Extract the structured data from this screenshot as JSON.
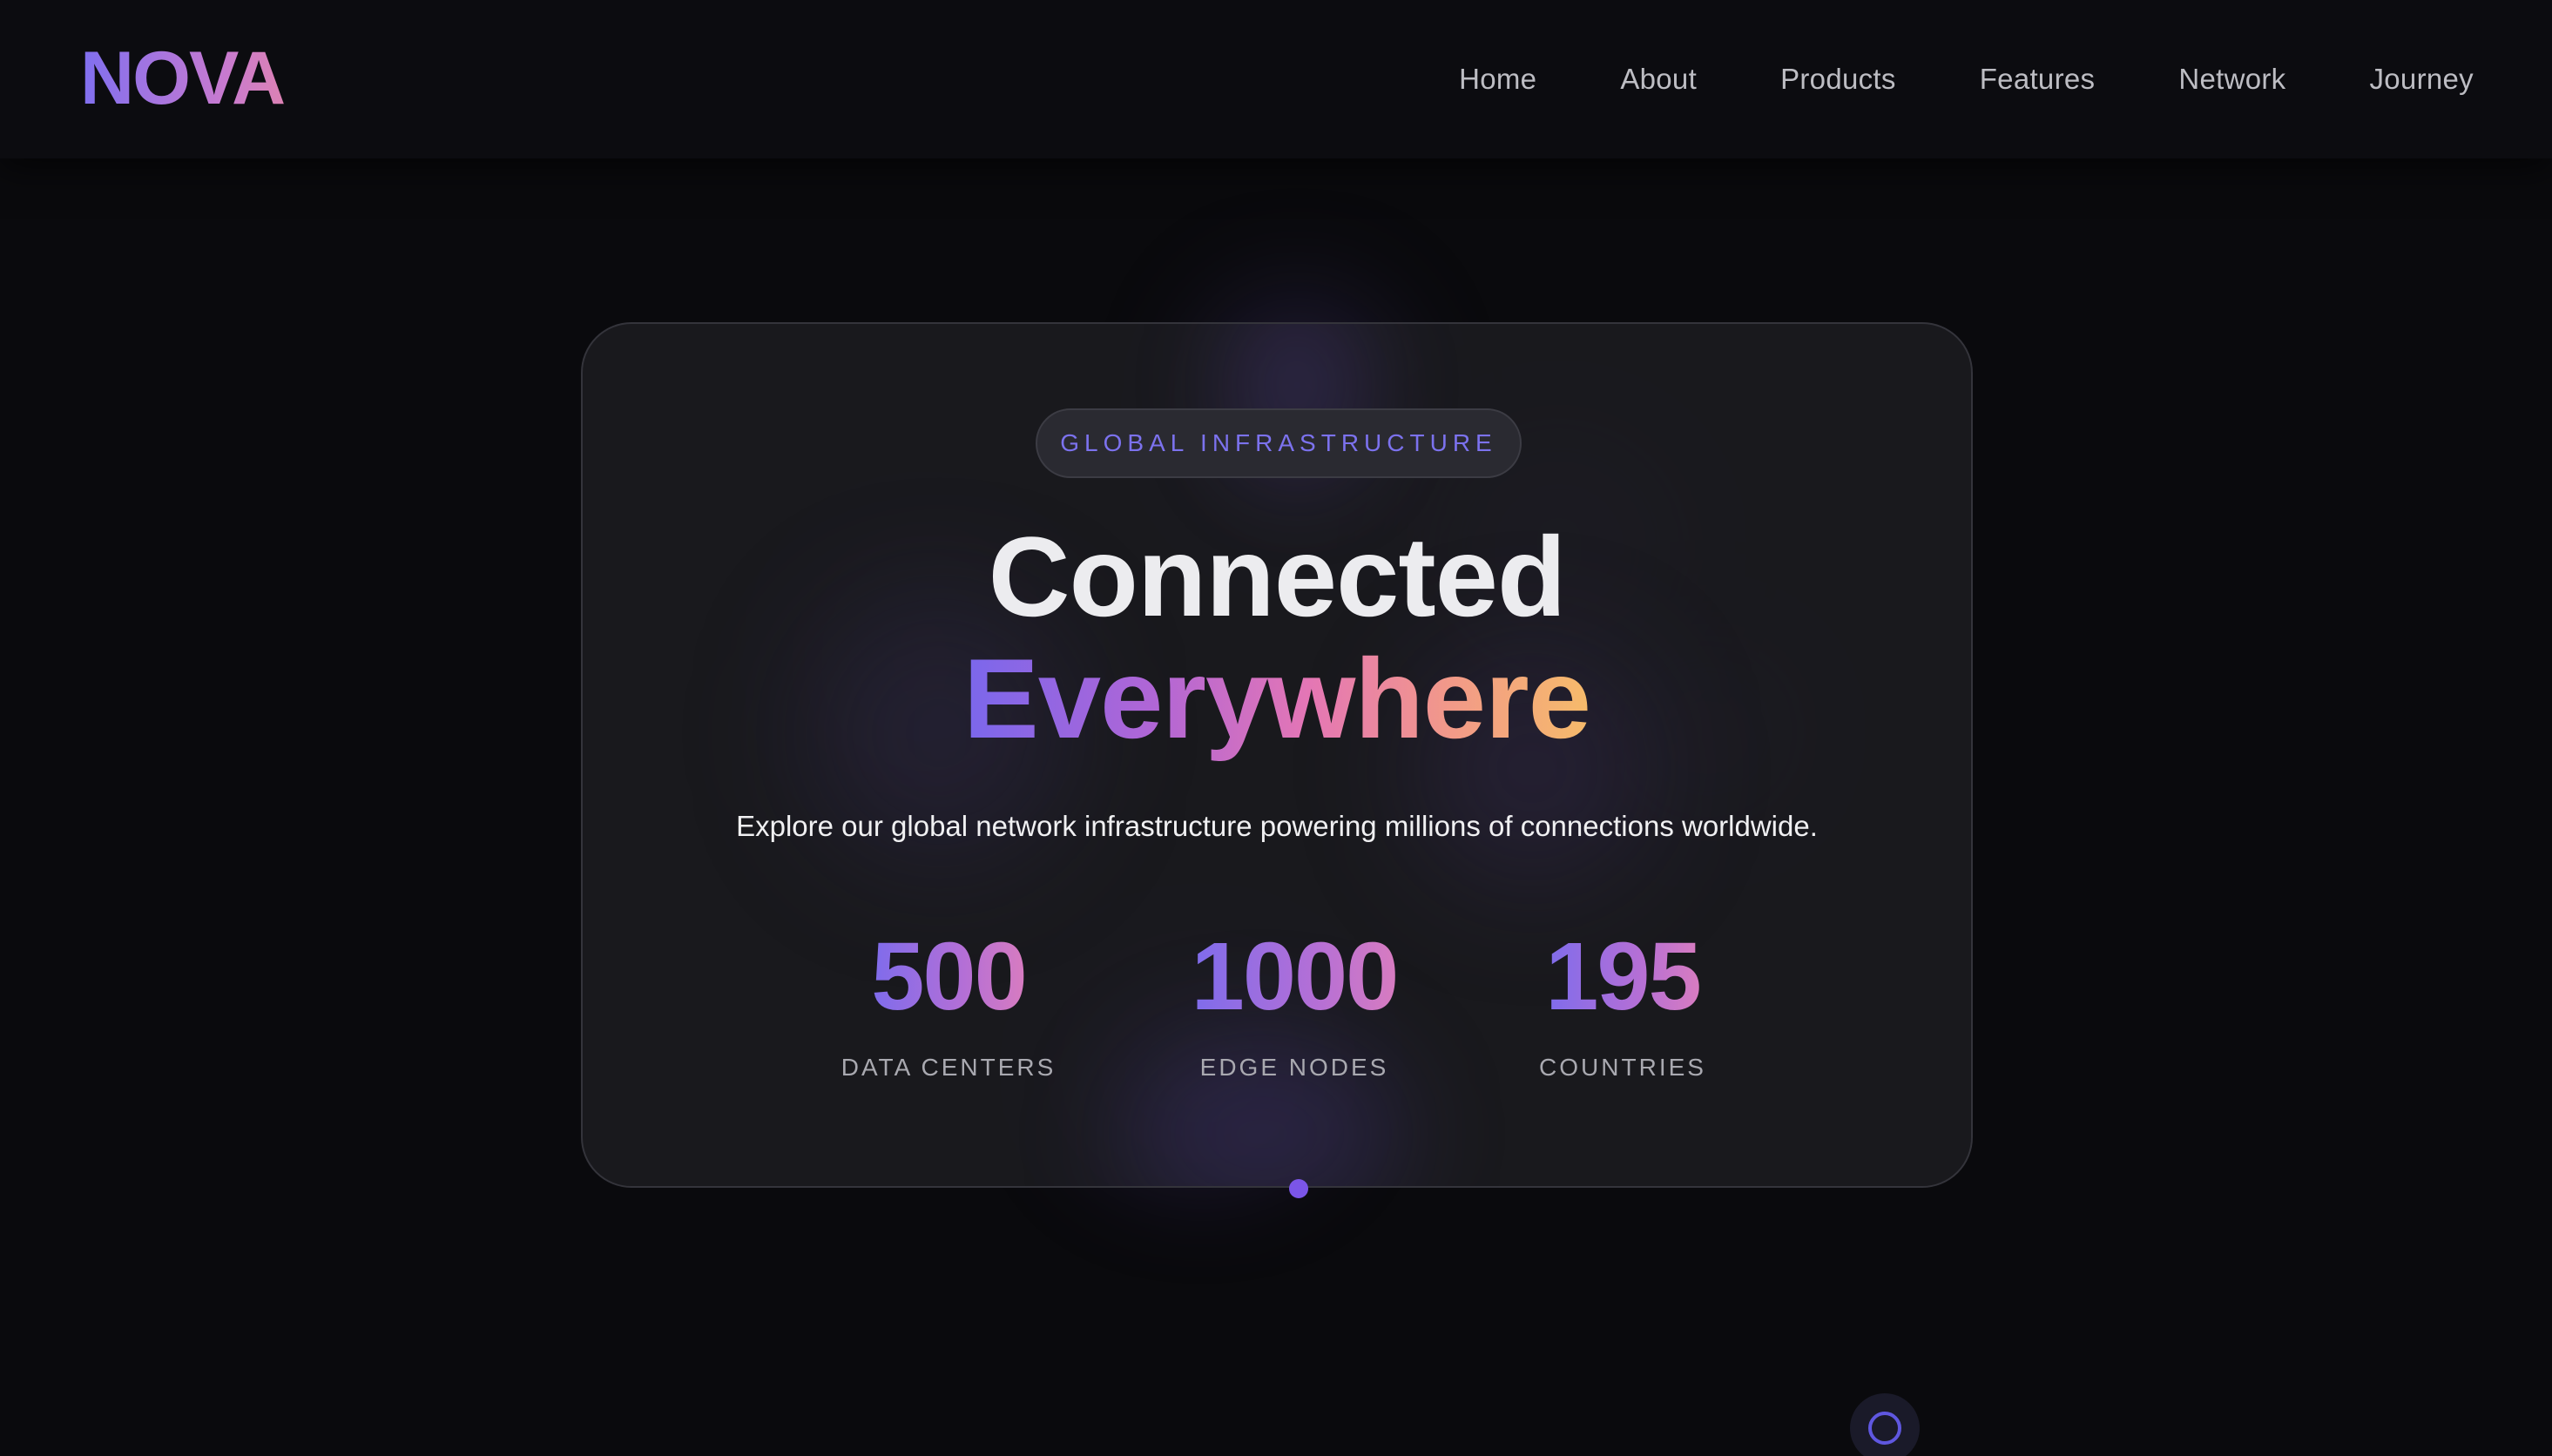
{
  "brand": {
    "logo": "NOVA"
  },
  "nav": {
    "items": [
      {
        "label": "Home"
      },
      {
        "label": "About"
      },
      {
        "label": "Products"
      },
      {
        "label": "Features"
      },
      {
        "label": "Network"
      },
      {
        "label": "Journey"
      }
    ]
  },
  "hero": {
    "badge": "GLOBAL INFRASTRUCTURE",
    "title_line1": "Connected",
    "title_line2": "Everywhere",
    "subtitle": "Explore our global network infrastructure powering millions of connections worldwide.",
    "stats": [
      {
        "value": "500",
        "label": "DATA CENTERS"
      },
      {
        "value": "1000",
        "label": "EDGE NODES"
      },
      {
        "value": "195",
        "label": "COUNTRIES"
      }
    ]
  },
  "floating_action": {
    "icon": "circle-icon"
  },
  "colors": {
    "background": "#0a0a0d",
    "accent_purple": "#7c72ee",
    "gradient_start": "#7a67ec",
    "gradient_mid": "#e476b5",
    "gradient_end": "#f6bb6a"
  }
}
